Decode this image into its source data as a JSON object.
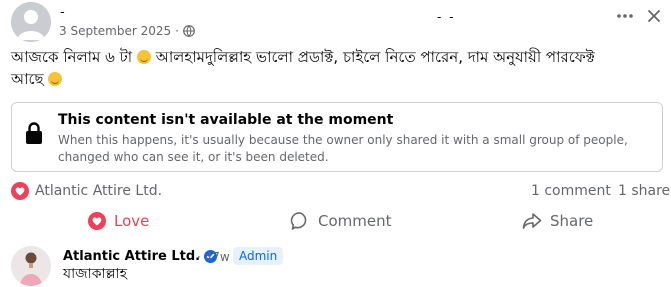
{
  "post": {
    "author_name": "-",
    "date": "3 September 2025",
    "separator": "·",
    "privacy_icon": "globe-icon",
    "middle_marks": "- -",
    "text_part1": "আজকে নিলাম ৬ টা",
    "text_part2": "আলহামদুলিল্লাহ ভালো প্রডাক্ট, চাইলে নিতে পারেন, দাম অনুযায়ী পারফেক্ট",
    "text_part3": "আছে"
  },
  "notice": {
    "title": "This content isn't available at the moment",
    "body": "When this happens, it's usually because the owner only shared it with a small group of people, changed who can see it, or it's been deleted."
  },
  "reactions": {
    "reactor": "Atlantic Attire Ltd.",
    "comments": "1 comment",
    "shares": "1 share"
  },
  "actions": {
    "love": "Love",
    "comment": "Comment",
    "share": "Share"
  },
  "comment": {
    "author": "Atlantic Attire Ltd.",
    "time": "47w",
    "badge": "Admin",
    "text": "যাজাকাল্লাহ"
  },
  "colors": {
    "love": "#f33e58",
    "secondary_text": "#65676b",
    "verified": "#0866ff"
  }
}
